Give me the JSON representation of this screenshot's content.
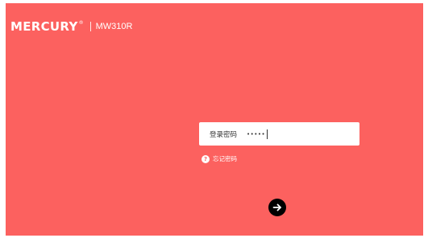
{
  "brand": {
    "logo": "MERCURY",
    "registered": "®",
    "model": "MW310R"
  },
  "login": {
    "password_label": "登录密码",
    "password_value": "•••••"
  },
  "forgot": {
    "icon": "?",
    "label": "忘记密码"
  },
  "submit": {
    "icon": "arrow-right-icon"
  },
  "colors": {
    "background": "#fc615f",
    "input_bg": "#ffffff",
    "submit_bg": "#000000"
  }
}
